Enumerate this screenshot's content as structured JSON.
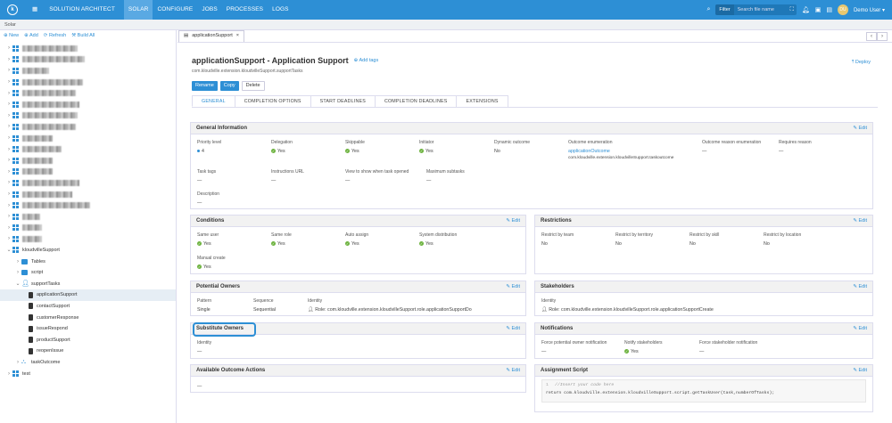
{
  "topbar": {
    "logo": "k",
    "brand": "SOLUTION ARCHITECT",
    "nav": [
      "SOLAR",
      "CONFIGURE",
      "JOBS",
      "PROCESSES",
      "LOGS"
    ],
    "active": "SOLAR",
    "filter": "Filter",
    "search_placeholder": "Search file name",
    "user": "Demo User",
    "avatar": "DU"
  },
  "breadcrumb": "Solar",
  "sidebar": {
    "toolbar": [
      "New",
      "Add",
      "Refresh",
      "Build All"
    ],
    "tree": [
      {
        "label": "kloudvilleSupport",
        "expanded": true
      },
      {
        "label": "Tables"
      },
      {
        "label": "script"
      },
      {
        "label": "supportTasks"
      },
      {
        "label": "applicationSupport"
      },
      {
        "label": "contactSupport"
      },
      {
        "label": "customerResponse"
      },
      {
        "label": "issueRespond"
      },
      {
        "label": "productSupport"
      },
      {
        "label": "reopenIssue"
      },
      {
        "label": "taskOutcome"
      },
      {
        "label": "test"
      }
    ]
  },
  "tab": {
    "label": "applicationSupport",
    "close": "×"
  },
  "page": {
    "title": "applicationSupport - Application Support",
    "add_tags": "Add tags",
    "subtitle": "com.kloudville.extension.kloudvilleSupport.supportTasks",
    "deploy": "Deploy",
    "buttons": [
      "Rename",
      "Copy",
      "Delete"
    ],
    "tabs": [
      "GENERAL",
      "COMPLETION OPTIONS",
      "START DEADLINES",
      "COMPLETION DEADLINES",
      "EXTENSIONS"
    ]
  },
  "edit": "Edit",
  "general": {
    "title": "General Information",
    "row1": [
      {
        "l": "Priority level",
        "v": "4"
      },
      {
        "l": "Delegation",
        "v": "Yes"
      },
      {
        "l": "Skippable",
        "v": "Yes"
      },
      {
        "l": "Initiator",
        "v": "Yes"
      },
      {
        "l": "Dynamic outcome",
        "v": "No"
      },
      {
        "l": "Outcome enumeration",
        "v": "applicationOutcome",
        "v2": "com.kloudville.extension.kloudvilleSupport.taskoutcome"
      },
      {
        "l": "Outcome reason enumeration",
        "v": "—"
      },
      {
        "l": "Requires reason",
        "v": "—"
      }
    ],
    "row2": [
      {
        "l": "Task tags",
        "v": "—"
      },
      {
        "l": "Instructions URL",
        "v": "—"
      },
      {
        "l": "View to show when task opened",
        "v": "—"
      },
      {
        "l": "Maximum subtasks",
        "v": "—"
      }
    ],
    "row3": [
      {
        "l": "Description",
        "v": "—"
      }
    ]
  },
  "conditions": {
    "title": "Conditions",
    "row1": [
      {
        "l": "Same user",
        "v": "Yes"
      },
      {
        "l": "Same role",
        "v": "Yes"
      },
      {
        "l": "Auto assign",
        "v": "Yes"
      },
      {
        "l": "System distribution",
        "v": "Yes"
      }
    ],
    "row2": [
      {
        "l": "Manual create",
        "v": "Yes"
      }
    ]
  },
  "restrictions": {
    "title": "Restrictions",
    "row1": [
      {
        "l": "Restrict by team",
        "v": "No"
      },
      {
        "l": "Restrict by territory",
        "v": "No"
      },
      {
        "l": "Restrict by skill",
        "v": "No"
      },
      {
        "l": "Restrict by location",
        "v": "No"
      }
    ]
  },
  "potential": {
    "title": "Potential Owners",
    "row1": [
      {
        "l": "Pattern",
        "v": "Single"
      },
      {
        "l": "Sequence",
        "v": "Sequential"
      },
      {
        "l": "Identity",
        "v": "Role: com.kloudville.extension.kloudvilleSupport.role.applicationSupportDo"
      }
    ]
  },
  "stakeholders": {
    "title": "Stakeholders",
    "row1": [
      {
        "l": "Identity",
        "v": "Role: com.kloudville.extension.kloudvilleSupport.role.applicationSupportCreate"
      }
    ]
  },
  "substitute": {
    "title": "Substitute Owners",
    "row1": [
      {
        "l": "Identity",
        "v": "—"
      }
    ]
  },
  "notifications": {
    "title": "Notifications",
    "row1": [
      {
        "l": "Force potential owner notification",
        "v": "—"
      },
      {
        "l": "Notify stakeholders",
        "v": "Yes"
      },
      {
        "l": "Force stakeholder notification",
        "v": "—"
      }
    ]
  },
  "outcome": {
    "title": "Available Outcome Actions",
    "v": "—"
  },
  "assignment": {
    "title": "Assignment Script",
    "line1_no": "1",
    "line1": "//Insert your code here",
    "line2": "return com.kloudville.extension.kloudvilleSupport.script.getTaskUser(task,numberOfTasks);"
  },
  "colors": {
    "accent": "#2d8fd5",
    "topbar": "#2d8fd5",
    "success": "#6db33f"
  }
}
